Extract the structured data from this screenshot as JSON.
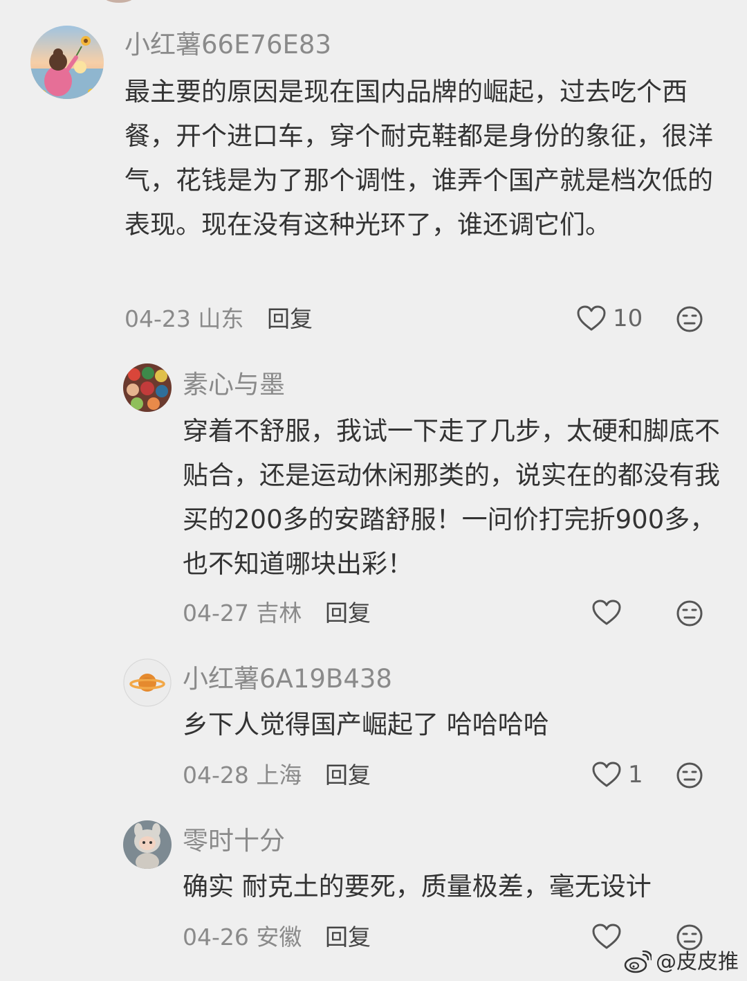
{
  "comments": [
    {
      "username": "小红薯66E76E83",
      "text": "最主要的原因是现在国内品牌的崛起，过去吃个西餐，开个进口车，穿个耐克鞋都是身份的象征，很洋气，花钱是为了那个调性，谁弄个国产就是档次低的表现。现在没有这种光环了，谁还调它们。",
      "date_location": "04-23 山东",
      "reply_label": "回复",
      "like_count": "10",
      "avatar_icon": "girl-sunflower-avatar"
    },
    {
      "username": "素心与墨",
      "text": "穿着不舒服，我试一下走了几步，太硬和脚底不贴合，还是运动休闲那类的，说实在的都没有我买的200多的安踏舒服！一问价打完折900多，也不知道哪块出彩！",
      "date_location": "04-27 吉林",
      "reply_label": "回复",
      "like_count": "",
      "avatar_icon": "dolls-collage-avatar"
    },
    {
      "username": "小红薯6A19B438",
      "text": "乡下人觉得国产崛起了 哈哈哈哈",
      "date_location": "04-28 上海",
      "reply_label": "回复",
      "like_count": "1",
      "avatar_icon": "planet-avatar"
    },
    {
      "username": "零时十分",
      "text": "确实 耐克土的要死，质量极差，毫无设计",
      "date_location": "04-26 安徽",
      "reply_label": "回复",
      "like_count": "",
      "avatar_icon": "toy-figure-avatar"
    }
  ],
  "watermark": {
    "text": "@皮皮推",
    "icon": "weibo-icon"
  },
  "colors": {
    "background": "#efefef",
    "username": "#8a8a8a",
    "text": "#333333"
  }
}
